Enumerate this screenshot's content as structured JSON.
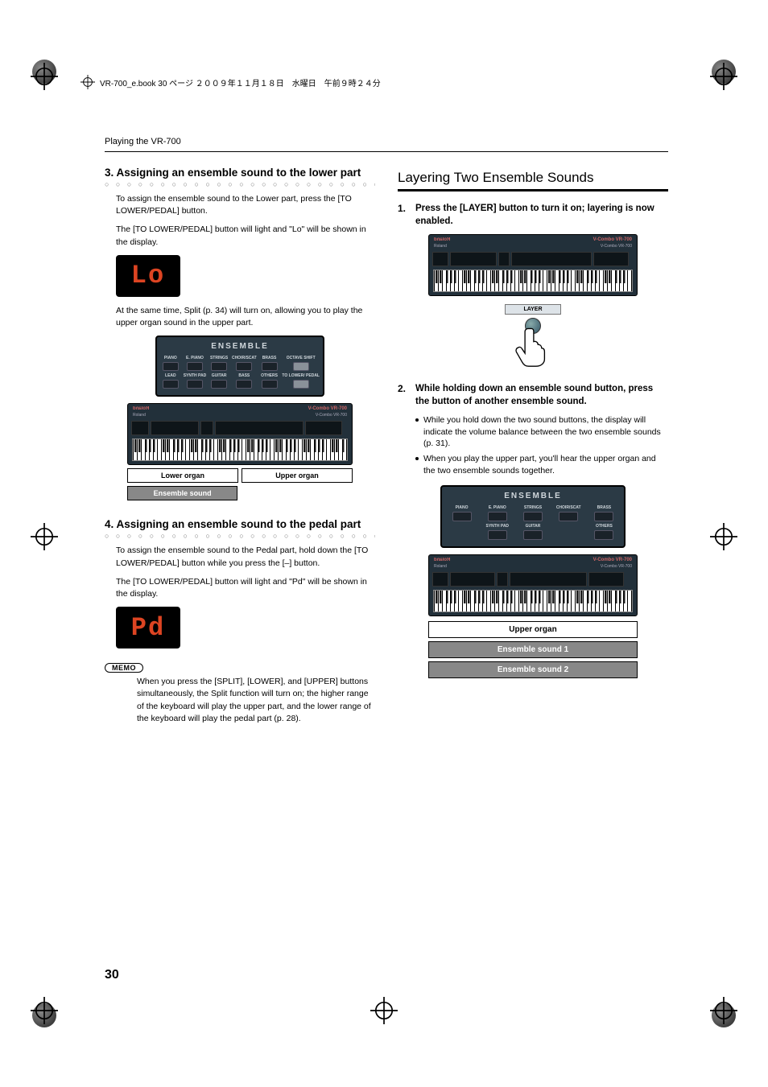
{
  "header_line": "VR-700_e.book  30 ページ  ２００９年１１月１８日　水曜日　午前９時２４分",
  "running_head": "Playing the VR-700",
  "page_number": "30",
  "left": {
    "s3_title": "3. Assigning an ensemble sound to the lower part",
    "s3_p1": "To assign the ensemble sound to the Lower part, press the [TO LOWER/PEDAL] button.",
    "s3_p2": "The [TO LOWER/PEDAL] button will light and \"Lo\" will be shown in the display.",
    "seg_lo": "Lo",
    "s3_p3": "At the same time, Split (p. 34) will turn on, allowing you to play the upper organ sound in the upper part.",
    "kbd_left_label": "Lower organ",
    "kbd_right_label": "Upper organ",
    "kbd_under_label": "Ensemble sound",
    "s4_title": "4. Assigning an ensemble sound to the pedal part",
    "s4_p1": "To assign the ensemble sound to the Pedal part, hold down the [TO LOWER/PEDAL] button while you press the [–] button.",
    "s4_p2": "The [TO LOWER/PEDAL] button will light and \"Pd\" will be shown in the display.",
    "seg_pd": "Pd",
    "memo_label": "MEMO",
    "memo_text": "When you press the [SPLIT], [LOWER], and [UPPER] buttons simultaneously, the Split function will turn on; the higher range of the keyboard will play the upper part, and the lower range of the keyboard will play the pedal part (p. 28)."
  },
  "right": {
    "section_title": "Layering Two Ensemble Sounds",
    "step1_n": "1.",
    "step1": "Press the [LAYER] button to turn it on; layering is now enabled.",
    "layer_label": "LAYER",
    "step2_n": "2.",
    "step2": "While holding down an ensemble sound button, press the button of another ensemble sound.",
    "b1": "While you hold down the two sound buttons, the display will indicate the volume balance between the two ensemble sounds (p. 31).",
    "b2": "When you play the upper part, you'll hear the upper organ and the two ensemble sounds together.",
    "stack1": "Upper organ",
    "stack2": "Ensemble sound 1",
    "stack3": "Ensemble sound 2"
  },
  "ensemble": {
    "title": "ENSEMBLE",
    "row1": [
      "PIANO",
      "E. PIANO",
      "STRINGS",
      "CHOIR/SCAT",
      "BRASS",
      "OCTAVE SHIFT"
    ],
    "row2": [
      "LEAD",
      "SYNTH PAD",
      "GUITAR",
      "BASS",
      "OTHERS",
      "TO LOWER/ PEDAL"
    ],
    "row1b": [
      "PIANO",
      "E. PIANO",
      "STRINGS",
      "CHOIR/SCAT",
      "BRASS"
    ],
    "row2b": [
      "",
      "SYNTH PAD",
      "GUITAR",
      "",
      "OTHERS"
    ]
  },
  "kbd": {
    "brand": "Roland",
    "model": "V-Combo VR-700"
  }
}
